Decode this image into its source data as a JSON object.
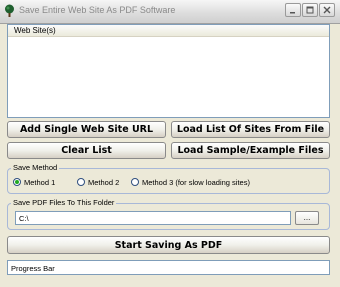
{
  "window": {
    "title": "Save Entire Web Site As PDF Software"
  },
  "list": {
    "header": "Web Site(s)"
  },
  "buttons": {
    "add_single": "Add Single Web Site URL",
    "load_list": "Load List Of Sites From File",
    "clear_list": "Clear List",
    "load_sample": "Load Sample/Example Files",
    "browse": "...",
    "start": "Start Saving As PDF"
  },
  "save_method": {
    "label": "Save Method",
    "options": [
      {
        "label": "Method 1",
        "selected": true
      },
      {
        "label": "Method 2",
        "selected": false
      },
      {
        "label": "Method 3 (for slow loading sites)",
        "selected": false
      }
    ]
  },
  "folder": {
    "label": "Save PDF Files To This Folder",
    "value": "C:\\"
  },
  "progress": {
    "text": "Progress Bar"
  },
  "colors": {
    "background": "#ece9d8",
    "field_border": "#7f9db9",
    "radio_selected": "#22aa22"
  },
  "icons": {
    "app": "tree-icon",
    "minimize": "minimize-icon",
    "maximize": "maximize-icon",
    "close": "close-icon"
  }
}
